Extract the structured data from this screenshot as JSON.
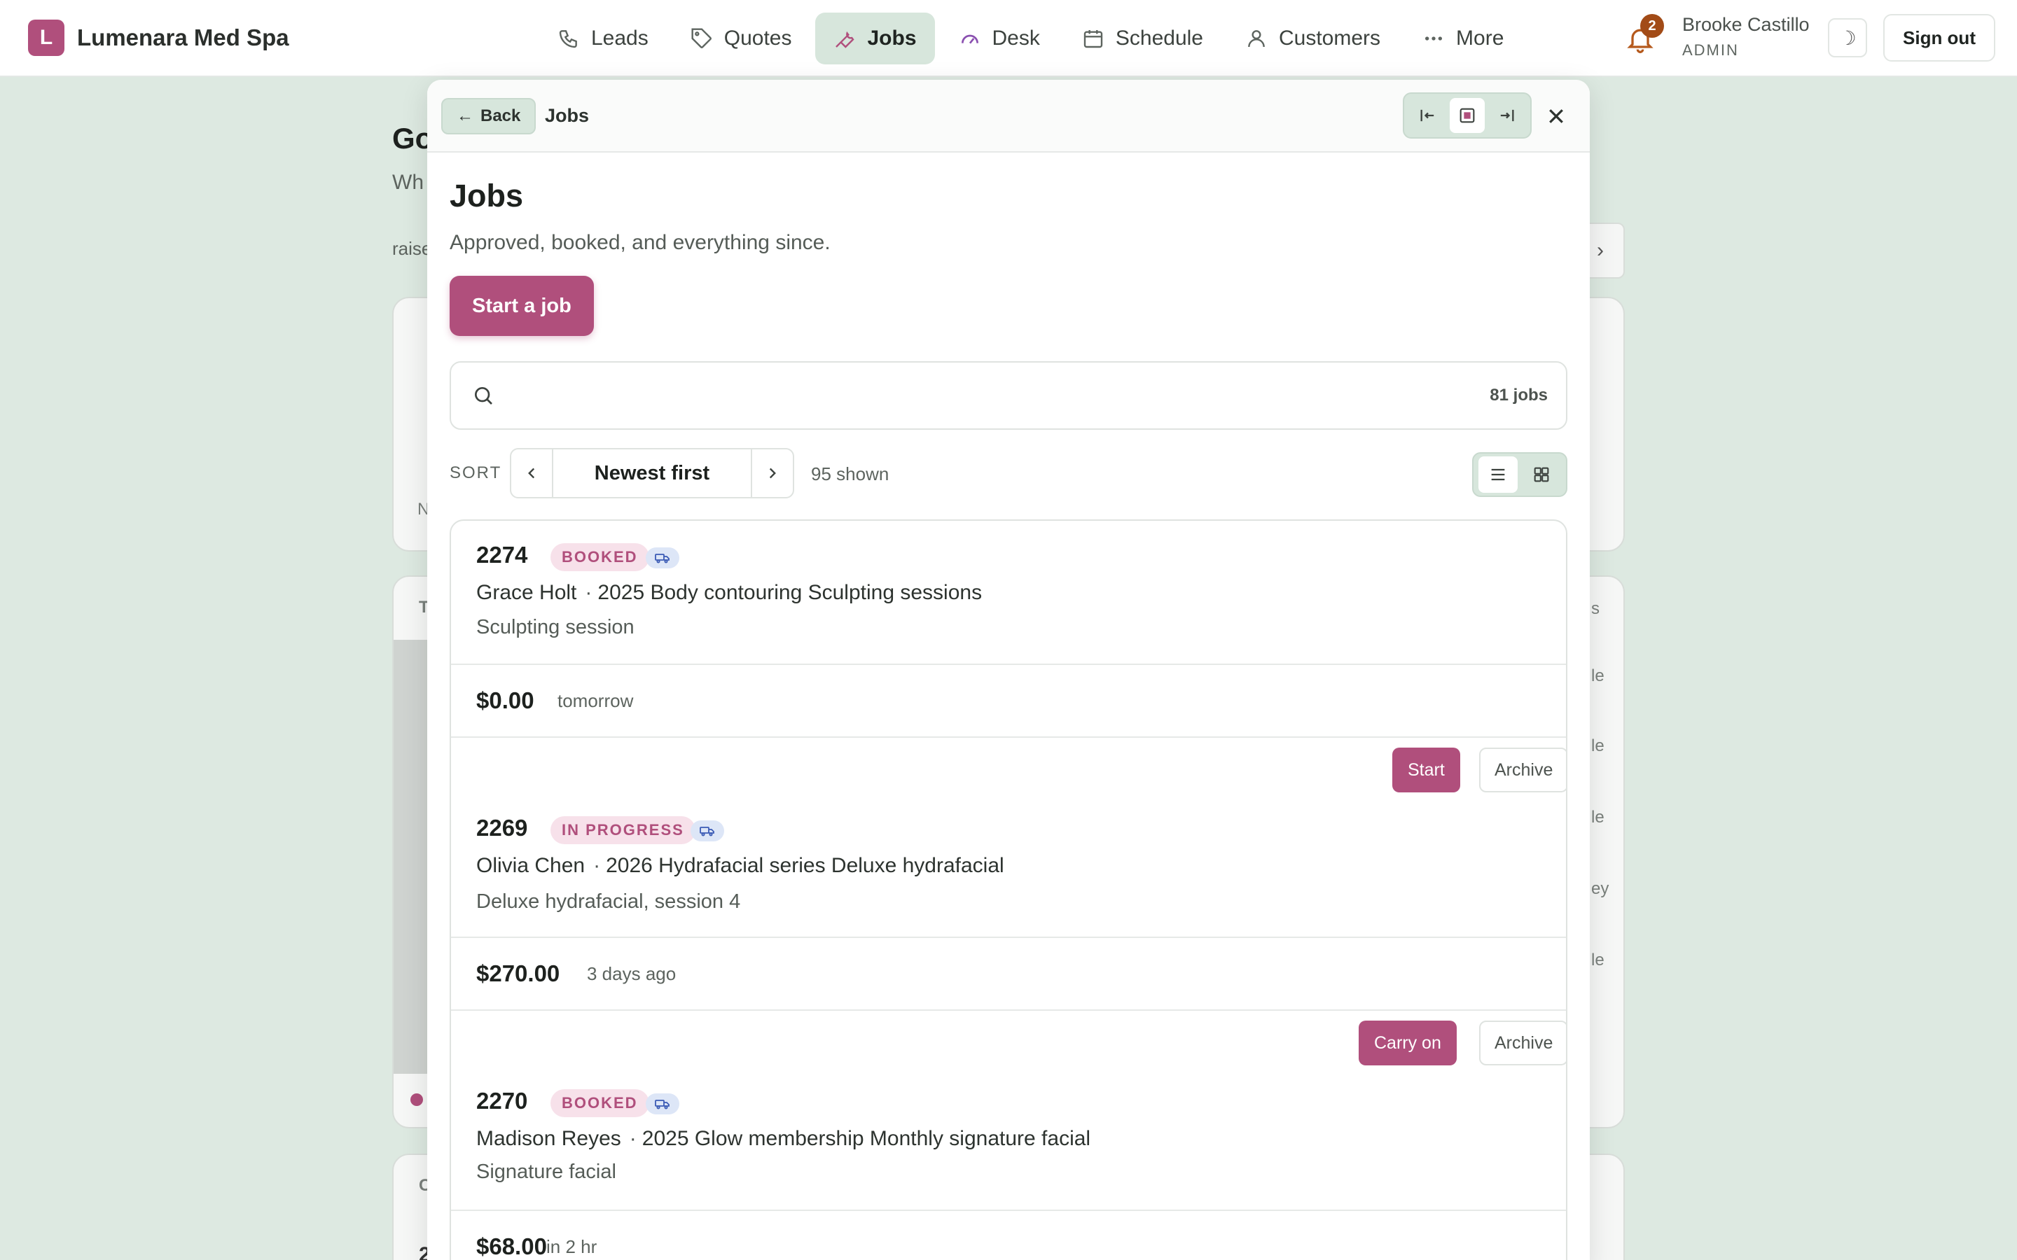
{
  "app": {
    "brand_initial": "L",
    "brand_name": "Lumenara Med Spa",
    "accent_color": "#b04f7c"
  },
  "nav": {
    "items": [
      {
        "label": "Leads",
        "icon": "phone-icon"
      },
      {
        "label": "Quotes",
        "icon": "tag-icon"
      },
      {
        "label": "Jobs",
        "icon": "wrench-icon",
        "active": true
      },
      {
        "label": "Desk",
        "icon": "gauge-icon"
      },
      {
        "label": "Schedule",
        "icon": "calendar-icon"
      },
      {
        "label": "Customers",
        "icon": "person-icon"
      },
      {
        "label": "More",
        "icon": "ellipsis-icon"
      }
    ]
  },
  "header": {
    "notifications_count": "2",
    "user_name": "Brooke Castillo",
    "user_role": "ADMIN",
    "theme_icon": "☽",
    "sign_out": "Sign out"
  },
  "background": {
    "title_fragment": "Go",
    "sub_fragment": "Wh",
    "raise_fragment": "raise",
    "card_fragment": "N",
    "t_fragment": "T",
    "c_fragment": "C",
    "row_fragments": [
      "s",
      "le",
      "le",
      "le",
      "ey",
      "le"
    ],
    "arrow": "›",
    "digit_fragment": "2"
  },
  "modal": {
    "back_label": "Back",
    "breadcrumb": "Jobs",
    "title": "Jobs",
    "subtitle": "Approved, booked, and everything since.",
    "start_button": "Start a job",
    "search_placeholder": "",
    "search_count": "81 jobs",
    "sort_label": "SORT",
    "sort_value": "Newest first",
    "shown": "95 shown"
  },
  "jobs": [
    {
      "number": "2274",
      "status": "BOOKED",
      "customer": "Grace Holt",
      "package": "2025 Body contouring Sculpting sessions",
      "detail": "Sculpting session",
      "price": "$0.00",
      "when": "tomorrow",
      "primary_action": "Start",
      "archive": "Archive"
    },
    {
      "number": "2269",
      "status": "IN PROGRESS",
      "customer": "Olivia Chen",
      "package": "2026 Hydrafacial series Deluxe hydrafacial",
      "detail": "Deluxe hydrafacial, session 4",
      "price": "$270.00",
      "when": "3 days ago",
      "primary_action": "Carry on",
      "archive": "Archive"
    },
    {
      "number": "2270",
      "status": "BOOKED",
      "customer": "Madison Reyes",
      "package": "2025 Glow membership Monthly signature facial",
      "detail": "Signature facial",
      "price": "$68.00",
      "when": "in 2 hr"
    }
  ]
}
